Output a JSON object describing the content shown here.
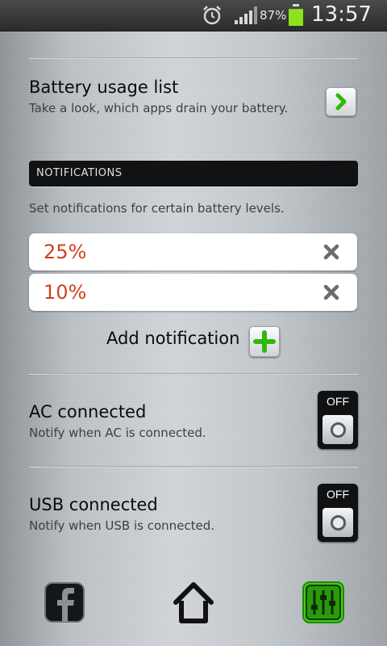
{
  "status_bar": {
    "battery_percent": "87%",
    "time": "13:57",
    "battery_level": 0.87
  },
  "battery_usage": {
    "title": "Battery usage list",
    "description": "Take a look, which apps drain your battery."
  },
  "notifications": {
    "header": "NOTIFICATIONS",
    "description": "Set notifications for certain battery levels.",
    "levels": [
      "25%",
      "10%"
    ],
    "add_label": "Add notification"
  },
  "ac": {
    "title": "AC connected",
    "description": "Notify when AC is connected.",
    "toggle": "OFF"
  },
  "usb": {
    "title": "USB connected",
    "description": "Notify when USB is connected.",
    "toggle": "OFF"
  },
  "colors": {
    "level_text": "#d3411a",
    "accent_green": "#3fcf13"
  }
}
